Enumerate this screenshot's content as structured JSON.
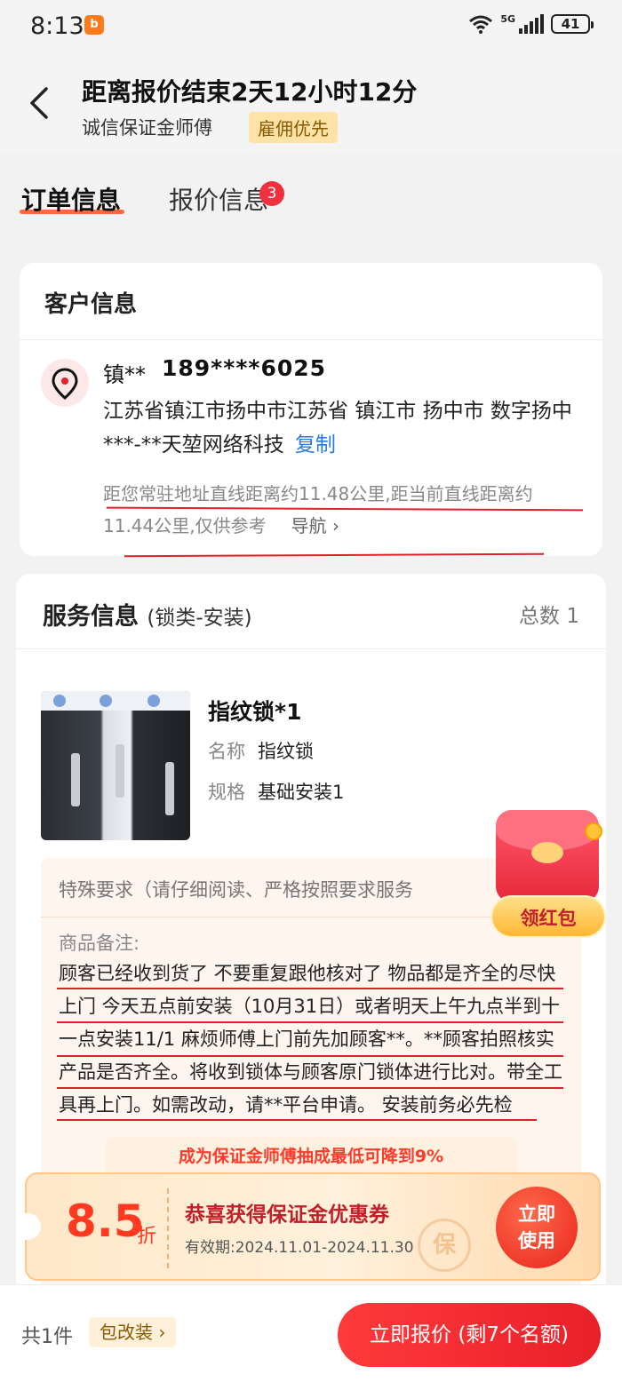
{
  "status_bar": {
    "time": "8:13",
    "network": "5G",
    "battery": "41"
  },
  "header": {
    "title": "距离报价结束2天12小时12分",
    "subtitle": "诚信保证金师傅",
    "badge": "雇佣优先"
  },
  "tabs": {
    "order": "订单信息",
    "quote": "报价信息",
    "quote_badge": "3"
  },
  "customer": {
    "section_title": "客户信息",
    "name": "镇**",
    "phone": "189****6025",
    "address": "江苏省镇江市扬中市江苏省 镇江市 扬中市 数字扬中***-**天堃网络科技",
    "copy_label": "复制",
    "distance": "距您常驻地址直线距离约11.48公里,距当前直线距离约11.44公里,仅供参考",
    "nav_label": "导航 ›"
  },
  "service": {
    "title": "服务信息",
    "subtitle": "(锁类-安装)",
    "total": "总数 1",
    "product": {
      "name": "指纹锁*1",
      "name_label": "名称",
      "name_value": "指纹锁",
      "spec_label": "规格",
      "spec_value": "基础安装1"
    },
    "special_title": "特殊要求（请仔细阅读、严格按照要求服务",
    "note_label": "商品备注:",
    "note_text": "顾客已经收到货了 不要重复跟他核对了 物品都是齐全的尽快上门 今天五点前安装（10月31日）或者明天上午九点半到十一点安装11/1 麻烦师傅上门前先加顾客**。**顾客拍照核实产品是否齐全。将收到锁体与顾客原门锁体进行比对。带全工具再上门。如需改动，请**平台申请。 安装前务必先检"
  },
  "red_packet": {
    "label": "领红包"
  },
  "promo": {
    "tip": "成为保证金师傅抽成最低可降到9%",
    "discount": "8.5",
    "discount_unit": "折",
    "title": "恭喜获得保证金优惠券",
    "valid": "有效期:2024.11.01-2024.11.30",
    "watermark": "保",
    "use_label": "立即使用"
  },
  "bottom": {
    "count": "共1件",
    "tag": "包改装 ›",
    "quote_button": "立即报价 (剩7个名额)"
  },
  "colors": {
    "accent_red": "#e8202a",
    "link_blue": "#2a7ae4",
    "badge_gold": "#ffe3a6"
  }
}
